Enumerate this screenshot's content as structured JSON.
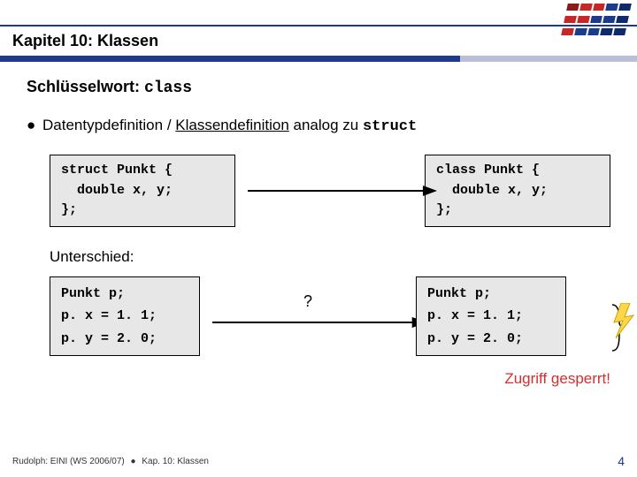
{
  "chapter": "Kapitel 10: Klassen",
  "keyword_line": {
    "prefix": "Schlüsselwort: ",
    "kw": "class"
  },
  "bullet": {
    "pre": "Datentypdefinition / ",
    "underlined": "Klassendefinition",
    "post": " analog zu ",
    "kw": "struct"
  },
  "code_left": "struct Punkt {\n  double x, y;\n};",
  "code_right": "class Punkt {\n  double x, y;\n};",
  "diff_label": "Unterschied:",
  "example_left": "Punkt p;\np. x = 1. 1;\np. y = 2. 0;",
  "example_right": "Punkt p;\np. x = 1. 1;\np. y = 2. 0;",
  "question": "?",
  "warn": "Zugriff gesperrt!",
  "footer": {
    "author": "Rudolph: EINI (WS 2006/07)",
    "chapter": "Kap. 10: Klassen",
    "page": "4"
  }
}
